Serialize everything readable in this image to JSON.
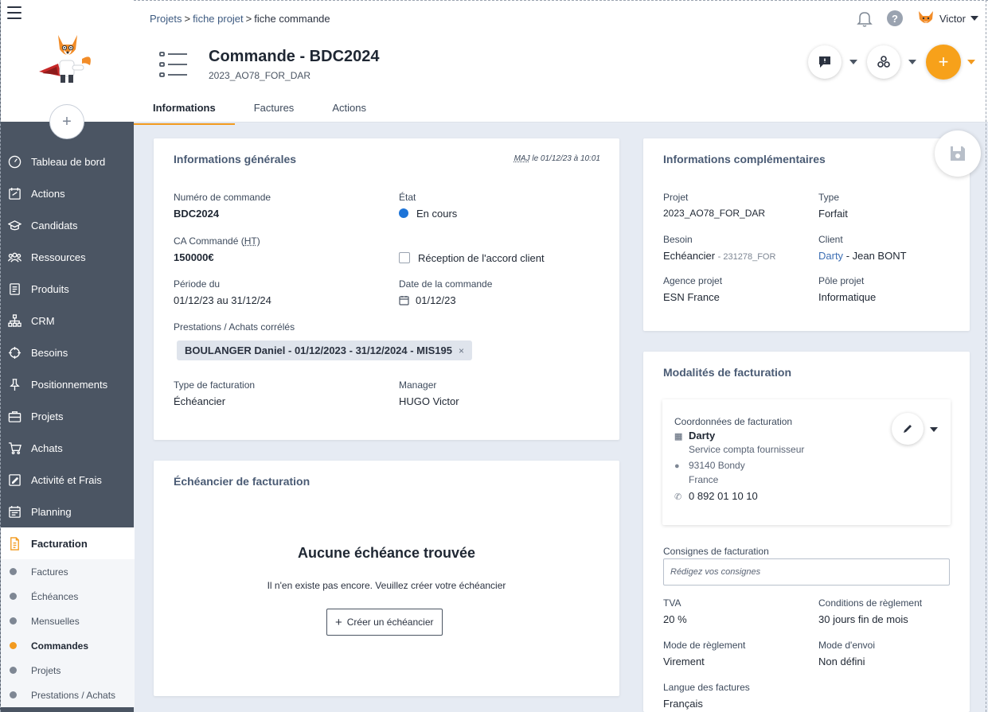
{
  "sidebar": {
    "items": [
      {
        "label": "Tableau de bord",
        "icon": "dashboard-icon"
      },
      {
        "label": "Actions",
        "icon": "actions-icon"
      },
      {
        "label": "Candidats",
        "icon": "graduation-cap-icon"
      },
      {
        "label": "Ressources",
        "icon": "people-icon"
      },
      {
        "label": "Produits",
        "icon": "product-list-icon"
      },
      {
        "label": "CRM",
        "icon": "org-chart-icon"
      },
      {
        "label": "Besoins",
        "icon": "target-icon"
      },
      {
        "label": "Positionnements",
        "icon": "pin-icon"
      },
      {
        "label": "Projets",
        "icon": "briefcase-icon"
      },
      {
        "label": "Achats",
        "icon": "cart-icon"
      },
      {
        "label": "Activité et Frais",
        "icon": "edit-note-icon"
      },
      {
        "label": "Planning",
        "icon": "calendar-icon"
      },
      {
        "label": "Facturation",
        "icon": "invoice-icon"
      }
    ],
    "subitems": [
      "Factures",
      "Échéances",
      "Mensuelles",
      "Commandes",
      "Projets",
      "Prestations / Achats"
    ]
  },
  "header": {
    "breadcrumb": [
      "Projets",
      "fiche projet",
      "fiche commande"
    ],
    "user_name": "Victor",
    "title": "Commande - BDC2024",
    "subtitle": "2023_AO78_FOR_DAR",
    "tabs": [
      "Informations",
      "Factures",
      "Actions"
    ]
  },
  "general": {
    "title": "Informations générales",
    "updated_prefix": "MAJ",
    "updated_rest": " le 01/12/23 à 10:01",
    "order_number_label": "Numéro de commande",
    "order_number": "BDC2024",
    "state_label": "État",
    "state": "En cours",
    "ca_label_prefix": "CA Commandé (",
    "ca_label_ht": "HT",
    "ca_label_suffix": ")",
    "ca_value": "150000€",
    "client_agreement_label": "Réception de l'accord client",
    "period_label": "Période du",
    "period_value": "01/12/23 au 31/12/24",
    "order_date_label": "Date de la commande",
    "order_date": "01/12/23",
    "related_label": "Prestations / Achats corrélés",
    "related_chip": "BOULANGER Daniel - 01/12/2023 - 31/12/2024 - MIS195",
    "chip_remove": "×",
    "billing_type_label": "Type de facturation",
    "billing_type": "Échéancier",
    "manager_label": "Manager",
    "manager": "HUGO Victor"
  },
  "schedule": {
    "title": "Échéancier de facturation",
    "empty_title": "Aucune échéance trouvée",
    "empty_text": "Il n'en existe pas encore. Veuillez créer votre échéancier",
    "create_button": "Créer un échéancier",
    "create_button_plus": "+"
  },
  "complementary": {
    "title": "Informations complémentaires",
    "project_label": "Projet",
    "project": "2023_AO78_FOR_DAR",
    "type_label": "Type",
    "type": "Forfait",
    "need_label": "Besoin",
    "need": "Echéancier",
    "need_ref": "- 231278_FOR",
    "client_label": "Client",
    "client_company": "Darty",
    "client_contact": "- Jean BONT",
    "agency_label": "Agence projet",
    "agency": "ESN France",
    "pole_label": "Pôle projet",
    "pole": "Informatique"
  },
  "billing": {
    "title": "Modalités de facturation",
    "coord_label": "Coordonnées de facturation",
    "coord_company": "Darty",
    "coord_service": "Service compta fournisseur",
    "coord_address_line1": "93140 Bondy",
    "coord_address_line2": "France",
    "coord_phone": "0 892 01 10 10",
    "instructions_label": "Consignes de facturation",
    "instructions_placeholder": "Rédigez vos consignes",
    "vat_label": "TVA",
    "vat": "20 %",
    "payment_terms_label": "Conditions de règlement",
    "payment_terms": "30 jours fin de mois",
    "payment_mode_label": "Mode de règlement",
    "payment_mode": "Virement",
    "send_mode_label": "Mode d'envoi",
    "send_mode": "Non défini",
    "language_label": "Langue des factures",
    "language": "Français"
  },
  "colors": {
    "accent": "#f29a1f",
    "sidebar_bg": "#4b5563",
    "status_blue": "#1d74d8",
    "link_blue": "#3d6fb4"
  }
}
